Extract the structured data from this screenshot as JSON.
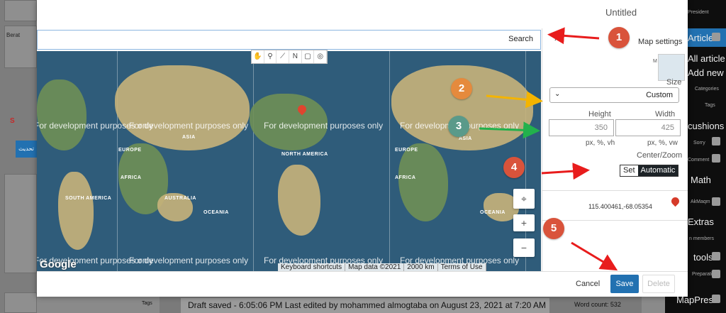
{
  "background": {
    "left_labels": [
      "Berat",
      "S",
      "تحديث"
    ],
    "right_menu": [
      {
        "label": "President",
        "size": "sm"
      },
      {
        "label": "Articles",
        "size": "big"
      },
      {
        "label": "All article",
        "size": "big"
      },
      {
        "label": "Add new",
        "size": "big"
      },
      {
        "label": "Categories",
        "size": "sm"
      },
      {
        "label": "Tags",
        "size": "sm"
      },
      {
        "label": "cushions",
        "size": "big"
      },
      {
        "label": "Sorry",
        "size": "sm"
      },
      {
        "label": "Comment",
        "size": "sm"
      },
      {
        "label": "Math",
        "size": "big"
      },
      {
        "label": "AkMaqm",
        "size": "sm"
      },
      {
        "label": "Extras",
        "size": "big"
      },
      {
        "label": "n members",
        "size": "sm"
      },
      {
        "label": "tools",
        "size": "big"
      },
      {
        "label": "Preparation",
        "size": "sm"
      },
      {
        "label": "MapPress",
        "size": "big"
      }
    ],
    "status": "Draft saved - 6:05:06 PM Last edited by mohammed almogtaba on August 23, 2021 at 7:20 AM",
    "word_count": "Word count: 532",
    "tags_label": "Tags"
  },
  "modal": {
    "title": "Untitled",
    "search_text": "Search",
    "map": {
      "watermark": "For development purposes only",
      "continents": [
        "ASIA",
        "EUROPE",
        "AFRICA",
        "SOUTH AMERICA",
        "NORTH AMERICA",
        "AUSTRALIA",
        "OCEANIA",
        "ASIA",
        "EUROPE",
        "AFRICA",
        "OCEANIA"
      ],
      "toolbar_icons": [
        "hand-icon",
        "pin-icon",
        "line-icon",
        "north-icon",
        "rectangle-icon",
        "circle-icon"
      ],
      "toolbar_glyphs": [
        "✋",
        "⚲",
        "⟋",
        "N",
        "▢",
        "◎"
      ],
      "zoom_in": "+",
      "zoom_out": "−",
      "locate": "⌖",
      "footer": [
        "Keyboard shortcuts",
        "Map data ©2021",
        "2000 km",
        "Terms of Use"
      ],
      "logo": "Google"
    },
    "settings": {
      "title": "Map settings",
      "thumb_label": "M",
      "size_label": "Size",
      "size_value": "Custom",
      "height_label": "Height",
      "width_label": "Width",
      "height_placeholder": "350",
      "width_placeholder": "425",
      "units_height": "px, %, vh",
      "units_width": "px, %, vw",
      "center_label": "Center/Zoom",
      "set_label": "Set",
      "auto_label": "Automatic",
      "poi_coords": "115.400461,-68.05354"
    },
    "buttons": {
      "cancel": "Cancel",
      "save": "Save",
      "delete": "Delete"
    }
  },
  "annotations": {
    "badges": [
      "1",
      "2",
      "3",
      "4",
      "5"
    ],
    "colors": {
      "red": "#d9533b",
      "orange": "#e58a3d",
      "teal": "#5a9a8a",
      "accent": "#2271b1"
    }
  }
}
